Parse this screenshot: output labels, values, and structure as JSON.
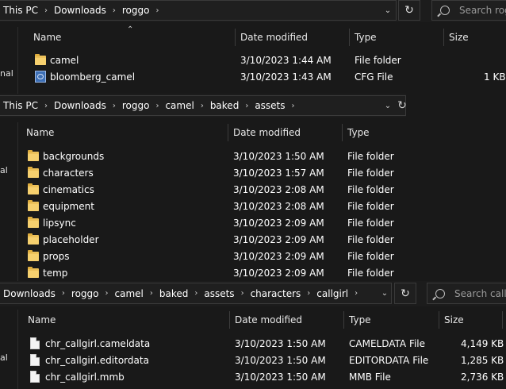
{
  "window1": {
    "breadcrumbs": [
      "This PC",
      "Downloads",
      "roggo"
    ],
    "search_placeholder": "Search rogg",
    "left_label": "nal",
    "columns": [
      "Name",
      "Date modified",
      "Type",
      "Size"
    ],
    "rows": [
      {
        "name": "camel",
        "date": "3/10/2023 1:44 AM",
        "type": "File folder",
        "size": "",
        "icon": "folder-icon"
      },
      {
        "name": "bloomberg_camel",
        "date": "3/10/2023 1:43 AM",
        "type": "CFG File",
        "size": "1 KB",
        "icon": "cfg-file-icon"
      }
    ]
  },
  "window2": {
    "breadcrumbs": [
      "This PC",
      "Downloads",
      "roggo",
      "camel",
      "baked",
      "assets"
    ],
    "left_label": "al",
    "columns": [
      "Name",
      "Date modified",
      "Type"
    ],
    "rows": [
      {
        "name": "backgrounds",
        "date": "3/10/2023 1:50 AM",
        "type": "File folder"
      },
      {
        "name": "characters",
        "date": "3/10/2023 1:57 AM",
        "type": "File folder"
      },
      {
        "name": "cinematics",
        "date": "3/10/2023 2:08 AM",
        "type": "File folder"
      },
      {
        "name": "equipment",
        "date": "3/10/2023 2:08 AM",
        "type": "File folder"
      },
      {
        "name": "lipsync",
        "date": "3/10/2023 2:09 AM",
        "type": "File folder"
      },
      {
        "name": "placeholder",
        "date": "3/10/2023 2:09 AM",
        "type": "File folder"
      },
      {
        "name": "props",
        "date": "3/10/2023 2:09 AM",
        "type": "File folder"
      },
      {
        "name": "temp",
        "date": "3/10/2023 2:09 AM",
        "type": "File folder"
      }
    ]
  },
  "window3": {
    "breadcrumbs": [
      "Downloads",
      "roggo",
      "camel",
      "baked",
      "assets",
      "characters",
      "callgirl"
    ],
    "search_placeholder": "Search callg",
    "left_label": "al",
    "columns": [
      "Name",
      "Date modified",
      "Type",
      "Size"
    ],
    "rows": [
      {
        "name": "chr_callgirl.cameldata",
        "date": "3/10/2023 1:50 AM",
        "type": "CAMELDATA File",
        "size": "4,149 KB"
      },
      {
        "name": "chr_callgirl.editordata",
        "date": "3/10/2023 1:50 AM",
        "type": "EDITORDATA File",
        "size": "1,285 KB"
      },
      {
        "name": "chr_callgirl.mmb",
        "date": "3/10/2023 1:50 AM",
        "type": "MMB File",
        "size": "2,736 KB"
      }
    ]
  },
  "glyphs": {
    "chevron": "›",
    "dropdown": "⌄",
    "refresh": "↻",
    "sort_up": "⌃"
  }
}
